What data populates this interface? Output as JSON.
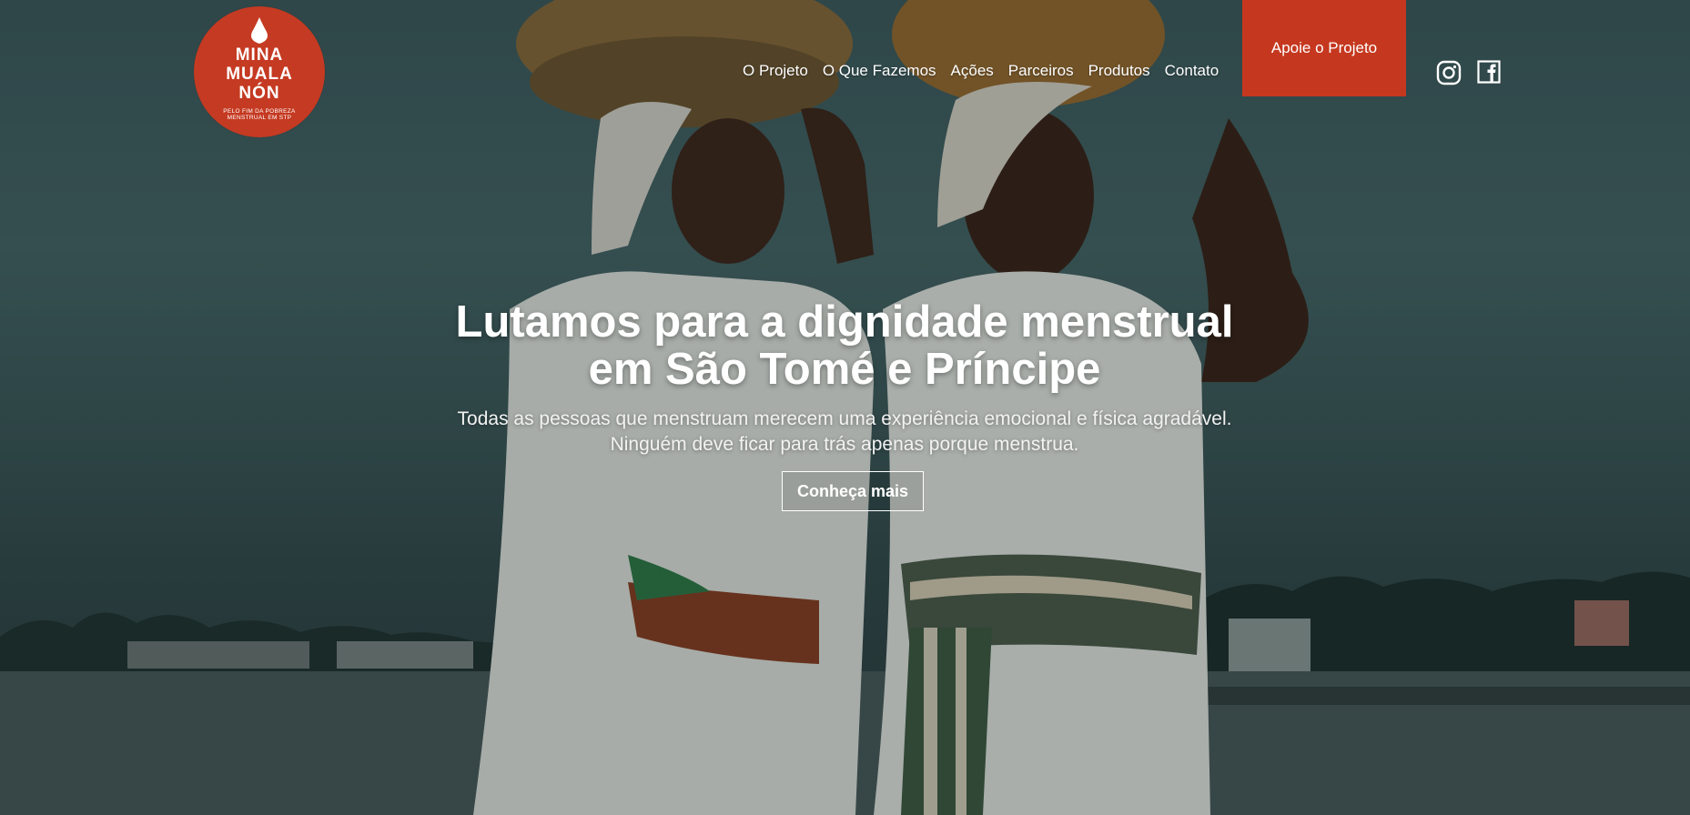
{
  "logo": {
    "line1": "MINA",
    "line2": "MUALA",
    "line3": "NÓN",
    "tagline": "PELO FIM DA POBREZA MENSTRUAL EM STP"
  },
  "nav": {
    "items": [
      "O Projeto",
      "O Que Fazemos",
      "Ações",
      "Parceiros",
      "Produtos",
      "Contato"
    ],
    "cta": "Apoie o Projeto"
  },
  "social": {
    "instagram": "instagram-icon",
    "facebook": "facebook-icon"
  },
  "hero": {
    "title_line1": "Lutamos para a dignidade menstrual",
    "title_line2": "em São Tomé e Príncipe",
    "subtitle_line1": "Todas as pessoas que menstruam merecem uma experiência emocional e física agradável.",
    "subtitle_line2": "Ninguém deve ficar para trás apenas porque menstrua.",
    "button": "Conheça mais"
  },
  "colors": {
    "brand": "#c5381f",
    "text": "#ffffff"
  }
}
